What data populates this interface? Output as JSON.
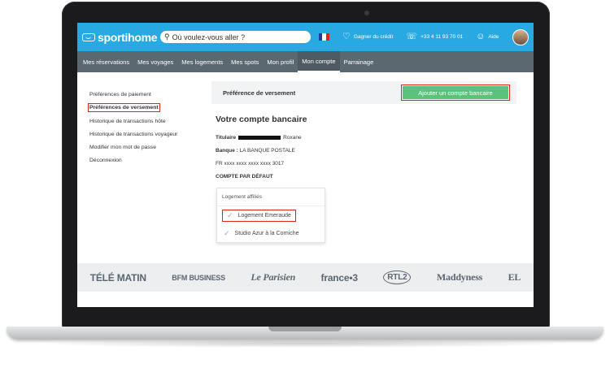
{
  "brand": {
    "name": "sportihome"
  },
  "search": {
    "placeholder": "Où voulez-vous aller ?"
  },
  "header": {
    "credit_label": "Gagner du crédit",
    "phone": "+33 4 11 93 70 01",
    "help_label": "Aide"
  },
  "colors": {
    "brand_blue": "#29a9e1",
    "nav_gray": "#5a6870",
    "button_green": "#5ac27b",
    "highlight_red": "#e2231a"
  },
  "nav": {
    "items": [
      "Mes réservations",
      "Mes voyages",
      "Mes logements",
      "Mes spots",
      "Mon profil",
      "Mon compte",
      "Parrainage"
    ],
    "active": "Mon compte"
  },
  "sidebar": {
    "items": [
      "Préférences de paiement",
      "Préférences de versement",
      "Historique de transactions hôte",
      "Historique de transactions voyageur",
      "Modifier mon mot de passe",
      "Déconnexion"
    ],
    "current": "Préférences de versement"
  },
  "panel": {
    "title": "Préférence de versement",
    "add_button": "Ajouter un compte bancaire"
  },
  "bank": {
    "heading": "Votre compte bancaire",
    "holder_label": "Titulaire",
    "holder_name": "Roxane",
    "bank_label": "Banque :",
    "bank_name": "LA BANQUE POSTALE",
    "iban": "FR xxxx xxxx xxxx xxxx 3017",
    "default_label": "COMPTE PAR DÉFAUT"
  },
  "dropdown": {
    "header": "Logement affiliés",
    "items": [
      "Logement Emeraude",
      "Studio Azur à la Corniche"
    ]
  },
  "press": {
    "logos": [
      "TÉLÉ MATIN",
      "BFM BUSINESS",
      "Le Parisien",
      "france•3",
      "RTL2",
      "Maddyness",
      "EL"
    ]
  }
}
